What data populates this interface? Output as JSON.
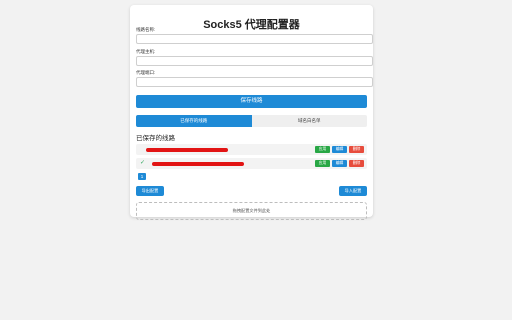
{
  "app": {
    "title": "Socks5 代理配置器"
  },
  "form": {
    "name_label": "线路名称:",
    "host_label": "代理主机:",
    "port_label": "代理端口:",
    "name_value": "",
    "host_value": "",
    "port_value": ""
  },
  "actions": {
    "save_label": "保存线路",
    "export_label": "导出配置",
    "import_label": "导入配置",
    "dropzone_text": "拖拽配置文件到此处"
  },
  "tabs": [
    {
      "label": "已保存的线路",
      "active": true
    },
    {
      "label": "域名白名单",
      "active": false
    }
  ],
  "saved": {
    "title": "已保存的线路",
    "rows": [
      {
        "name": "",
        "selected": false,
        "redacted": true
      },
      {
        "name": "",
        "selected": true,
        "check": "✓",
        "redacted": true
      }
    ],
    "row_buttons": {
      "apply": "应用",
      "edit": "编辑",
      "delete": "删除"
    }
  },
  "pagination": {
    "current_page": "1"
  },
  "colors": {
    "accent": "#1e8ad6",
    "apply": "#28a745",
    "delete": "#e74c3c",
    "redaction": "#e21414"
  }
}
